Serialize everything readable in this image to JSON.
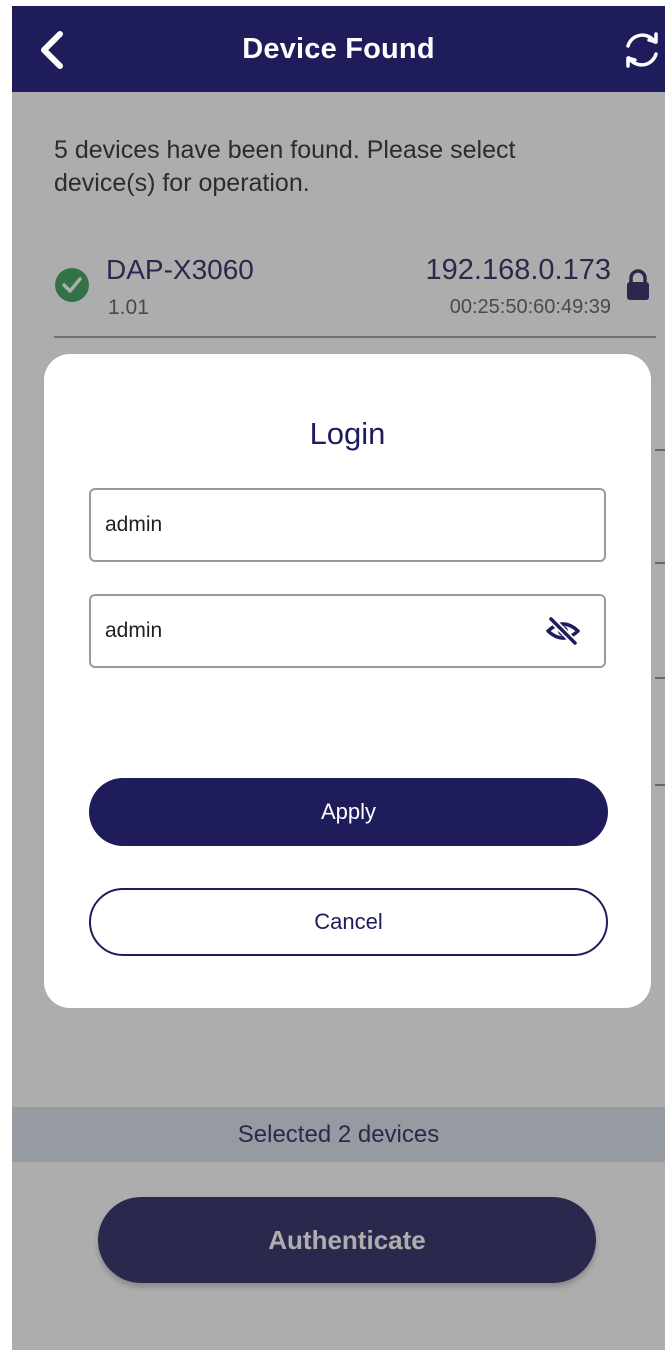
{
  "header": {
    "title": "Device Found",
    "back_icon": "chevron-left-icon",
    "refresh_icon": "refresh-icon"
  },
  "intro_text": "5 devices have been found. Please select device(s) for operation.",
  "device": {
    "name": "DAP-X3060",
    "firmware": "1.01",
    "ip": "192.168.0.173",
    "mac": "00:25:50:60:49:39",
    "status_icon": "check-circle-icon",
    "lock_icon": "lock-icon"
  },
  "selection_status": "Selected 2 devices",
  "authenticate_label": "Authenticate",
  "login_dialog": {
    "title": "Login",
    "username_value": "admin",
    "password_value": "admin",
    "visibility_icon": "eye-off-icon",
    "apply_label": "Apply",
    "cancel_label": "Cancel"
  },
  "colors": {
    "primary": "#1e1c5a",
    "success": "#2e9a4f",
    "status_bar": "#d6e0ea"
  }
}
